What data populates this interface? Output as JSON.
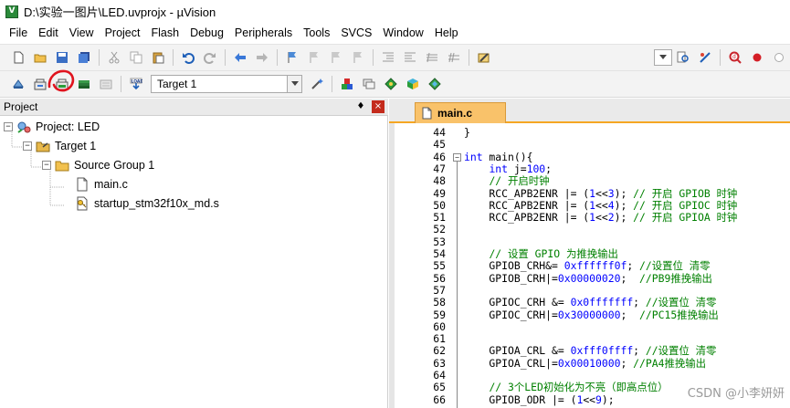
{
  "window": {
    "title": "D:\\实验一图片\\LED.uvprojx - µVision",
    "app_icon_letter": "V"
  },
  "menu": [
    "File",
    "Edit",
    "View",
    "Project",
    "Flash",
    "Debug",
    "Peripherals",
    "Tools",
    "SVCS",
    "Window",
    "Help"
  ],
  "toolbar2": {
    "target_label": "Target 1"
  },
  "project_panel": {
    "title": "Project",
    "pin_glyph": "♦",
    "close_glyph": "×",
    "tree": {
      "root_label": "Project: LED",
      "target_label": "Target 1",
      "group_label": "Source Group 1",
      "files": [
        "main.c",
        "startup_stm32f10x_md.s"
      ]
    }
  },
  "editor": {
    "tab_label": "main.c",
    "lines": [
      {
        "n": "44",
        "t": "}"
      },
      {
        "n": "45",
        "t": ""
      },
      {
        "n": "46",
        "t": "int main(){"
      },
      {
        "n": "47",
        "t": "    int j=100;"
      },
      {
        "n": "48",
        "t": "    // 开启时钟"
      },
      {
        "n": "49",
        "t": "    RCC_APB2ENR |= (1<<3); // 开启 GPIOB 时钟"
      },
      {
        "n": "50",
        "t": "    RCC_APB2ENR |= (1<<4); // 开启 GPIOC 时钟"
      },
      {
        "n": "51",
        "t": "    RCC_APB2ENR |= (1<<2); // 开启 GPIOA 时钟"
      },
      {
        "n": "52",
        "t": ""
      },
      {
        "n": "53",
        "t": ""
      },
      {
        "n": "54",
        "t": "    // 设置 GPIO 为推挽输出"
      },
      {
        "n": "55",
        "t": "    GPIOB_CRH&= 0xffffff0f; //设置位 清零"
      },
      {
        "n": "56",
        "t": "    GPIOB_CRH|=0x00000020;  //PB9推挽输出"
      },
      {
        "n": "57",
        "t": ""
      },
      {
        "n": "58",
        "t": "    GPIOC_CRH &= 0x0fffffff; //设置位 清零"
      },
      {
        "n": "59",
        "t": "    GPIOC_CRH|=0x30000000;  //PC15推挽输出"
      },
      {
        "n": "60",
        "t": ""
      },
      {
        "n": "61",
        "t": ""
      },
      {
        "n": "62",
        "t": "    GPIOA_CRL &= 0xfff0ffff; //设置位 清零"
      },
      {
        "n": "63",
        "t": "    GPIOA_CRL|=0x00010000; //PA4推挽输出"
      },
      {
        "n": "64",
        "t": ""
      },
      {
        "n": "65",
        "t": "    // 3个LED初始化为不亮（即高点位）"
      },
      {
        "n": "66",
        "t": "    GPIOB_ODR |= (1<<9);"
      }
    ]
  },
  "watermark": "CSDN @小李妍妍"
}
